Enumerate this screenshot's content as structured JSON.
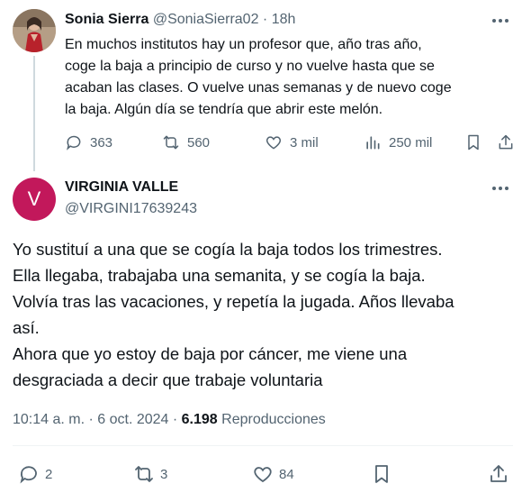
{
  "parent_tweet": {
    "display_name": "Sonia Sierra",
    "handle": "@SoniaSierra02",
    "separator": " · ",
    "time": "18h",
    "text": "En muchos institutos hay un profesor que, año tras año,\ncoge la baja a principio de curso y no vuelve hasta que se\nacaban las clases. O vuelve unas semanas y de nuevo coge\nla baja. Algún día se tendría que abrir este melón.",
    "replies": "363",
    "reposts": "560",
    "likes": "3 mil",
    "views": "250 mil"
  },
  "reply_tweet": {
    "avatar_letter": "V",
    "display_name": "VIRGINIA VALLE",
    "handle": "@VIRGINI17639243",
    "text": "Yo sustituí a una que se cogía la baja todos los trimestres.\nElla llegaba, trabajaba una semanita, y se cogía la baja.\nVolvía tras las vacaciones, y repetía la jugada. Años llevaba\nasí.\nAhora que yo estoy de baja por cáncer, me viene una\ndesgraciada a decir que trabaje voluntaria",
    "timestamp": "10:14 a. m. · 6 oct. 2024 · ",
    "view_count": "6.198",
    "views_label": " Reproducciones",
    "replies": "2",
    "reposts": "3",
    "likes": "84"
  },
  "colors": {
    "text_primary": "#0f1419",
    "text_secondary": "#536471",
    "thread_line": "#cfd9de",
    "avatar_bg": "#c2185b"
  },
  "icons": [
    "more-icon",
    "reply-icon",
    "repost-icon",
    "like-icon",
    "views-icon",
    "bookmark-icon",
    "share-icon"
  ]
}
